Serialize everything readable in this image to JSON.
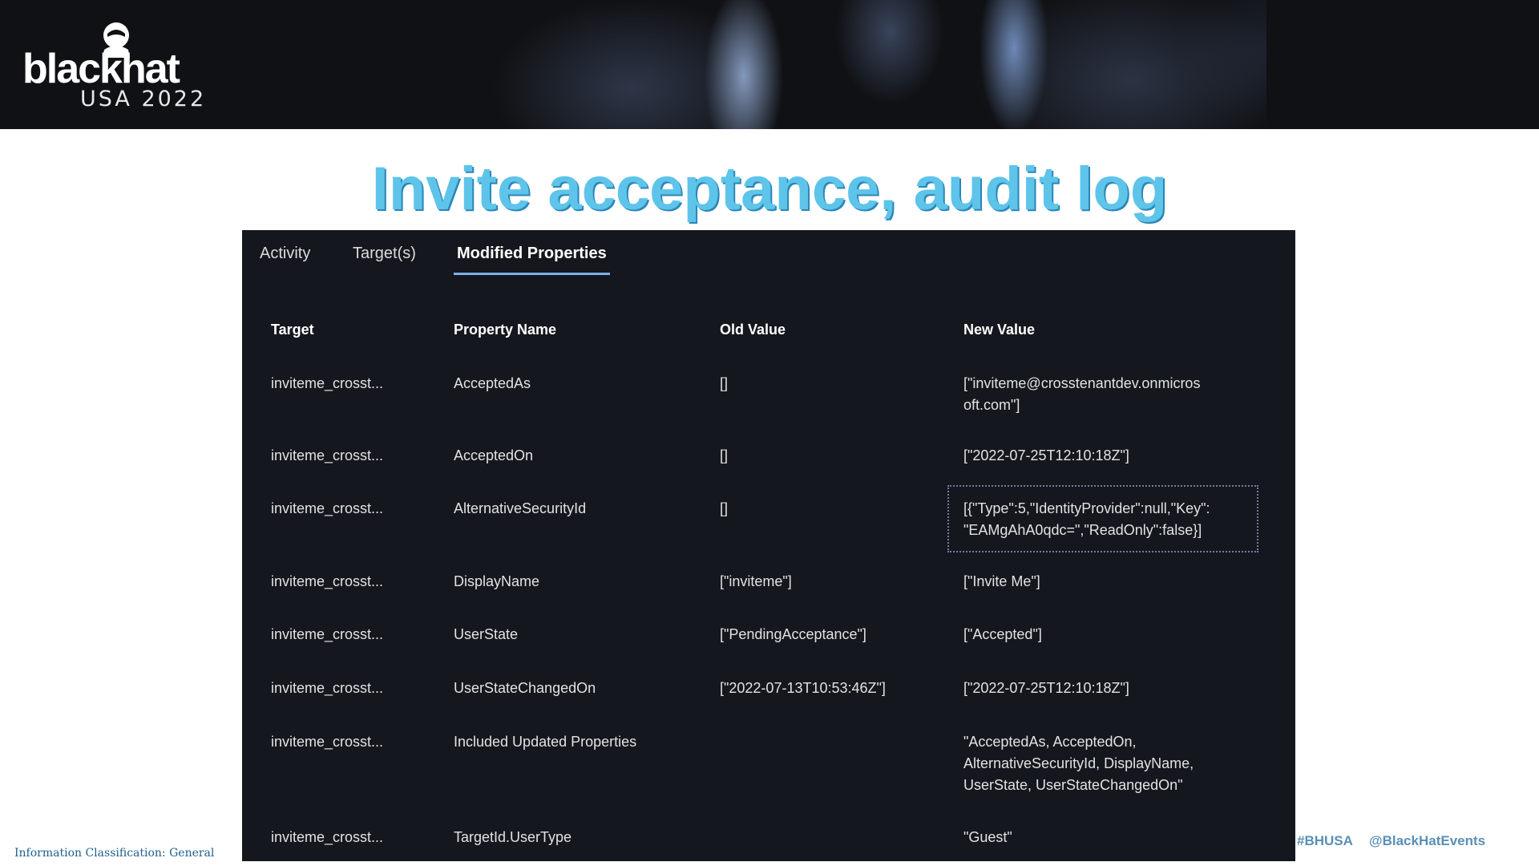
{
  "brand": {
    "logo_word": "blackhat",
    "logo_sub": "USA 2022"
  },
  "slide": {
    "title": "Invite acceptance, audit log",
    "classification": "Information Classification: General",
    "hashtag": "#BHUSA",
    "handle": "@BlackHatEvents"
  },
  "tabs": [
    {
      "label": "Activity",
      "active": false
    },
    {
      "label": "Target(s)",
      "active": false
    },
    {
      "label": "Modified Properties",
      "active": true
    }
  ],
  "table": {
    "headers": [
      "Target",
      "Property Name",
      "Old Value",
      "New Value"
    ],
    "rows": [
      {
        "target": "inviteme_crosst...",
        "property": "AcceptedAs",
        "old": "[]",
        "new": "[\"inviteme@crosstenantdev.onmicros\noft.com\"]"
      },
      {
        "target": "inviteme_crosst...",
        "property": "AcceptedOn",
        "old": "[]",
        "new": "[\"2022-07-25T12:10:18Z\"]"
      },
      {
        "target": "inviteme_crosst...",
        "property": "AlternativeSecurityId",
        "old": "[]",
        "new": "[{\"Type\":5,\"IdentityProvider\":null,\"Key\":\n\"EAMgAhA0qdc=\",\"ReadOnly\":false}]"
      },
      {
        "target": "inviteme_crosst...",
        "property": "DisplayName",
        "old": "[\"inviteme\"]",
        "new": "[\"Invite Me\"]"
      },
      {
        "target": "inviteme_crosst...",
        "property": "UserState",
        "old": "[\"PendingAcceptance\"]",
        "new": "[\"Accepted\"]"
      },
      {
        "target": "inviteme_crosst...",
        "property": "UserStateChangedOn",
        "old": "[\"2022-07-13T10:53:46Z\"]",
        "new": "[\"2022-07-25T12:10:18Z\"]"
      },
      {
        "target": "inviteme_crosst...",
        "property": "Included Updated Properties",
        "old": "",
        "new": "\"AcceptedAs, AcceptedOn,\nAlternativeSecurityId, DisplayName,\nUserState, UserStateChangedOn\""
      },
      {
        "target": "inviteme_crosst...",
        "property": "TargetId.UserType",
        "old": "",
        "new": "\"Guest\""
      }
    ]
  }
}
